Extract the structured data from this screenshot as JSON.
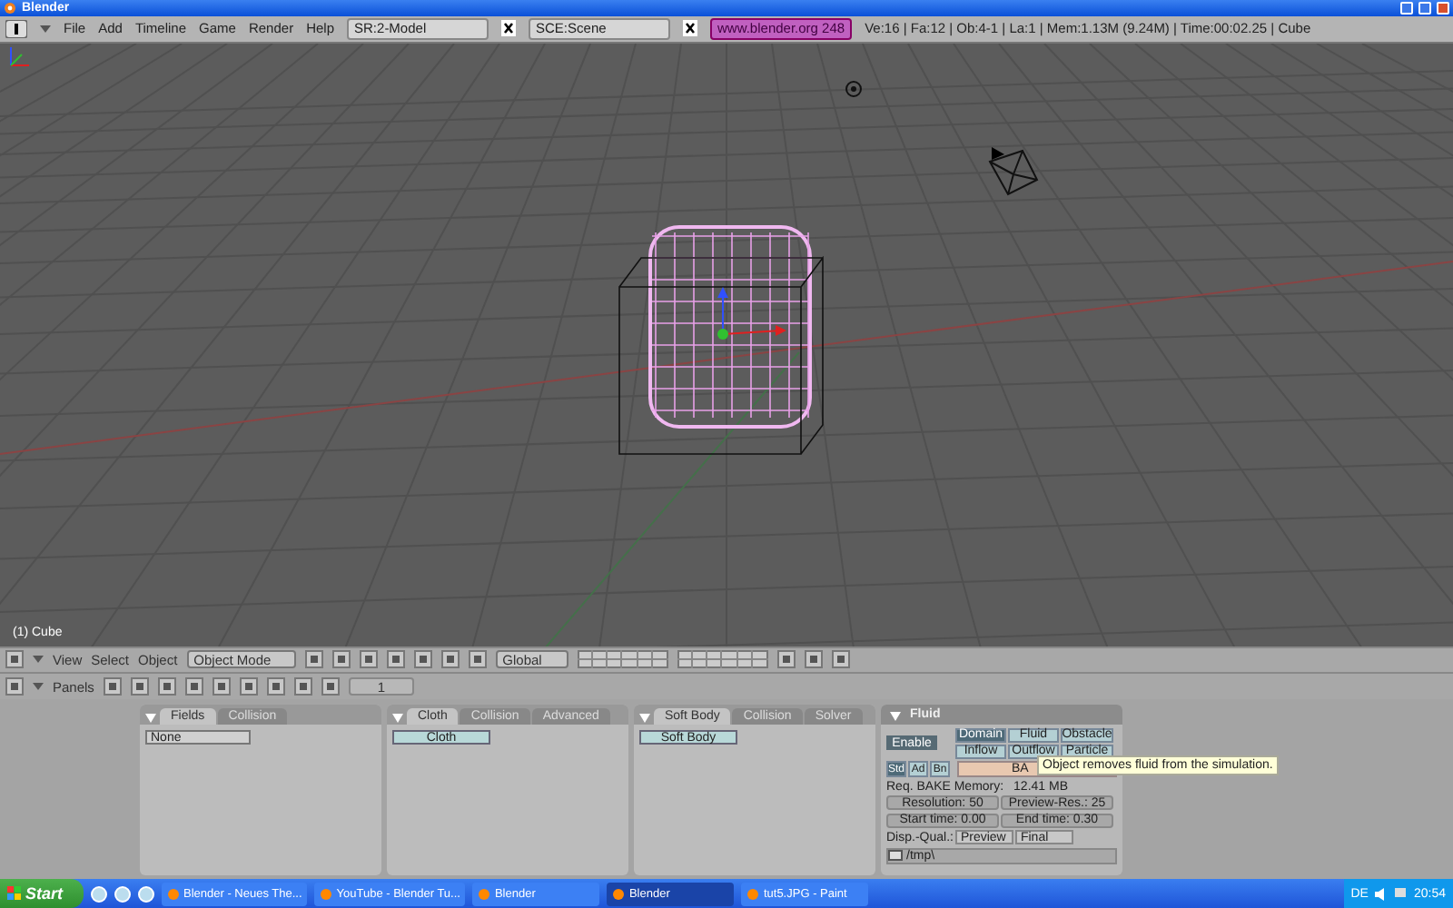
{
  "window": {
    "title": "Blender"
  },
  "info_header": {
    "menus": [
      "File",
      "Add",
      "Timeline",
      "Game",
      "Render",
      "Help"
    ],
    "screen": "SR:2-Model",
    "scene": "SCE:Scene",
    "link": "www.blender.org 248",
    "stats": "Ve:16 | Fa:12 | Ob:4-1 | La:1  | Mem:1.13M (9.24M)  | Time:00:02.25 | Cube"
  },
  "viewport": {
    "object_label": "(1) Cube"
  },
  "view3d_header": {
    "menus": [
      "View",
      "Select",
      "Object"
    ],
    "mode": "Object Mode",
    "orientation": "Global"
  },
  "buttons_header": {
    "label": "Panels",
    "frame": "1"
  },
  "panels": [
    {
      "tabs": [
        {
          "label": "Fields",
          "selected": true
        },
        {
          "label": "Collision",
          "selected": false
        }
      ],
      "control": {
        "kind": "dropdown",
        "label": "None"
      }
    },
    {
      "tabs": [
        {
          "label": "Cloth",
          "selected": true
        },
        {
          "label": "Collision",
          "selected": false
        },
        {
          "label": "Advanced",
          "selected": false
        }
      ],
      "control": {
        "kind": "button",
        "label": "Cloth"
      }
    },
    {
      "tabs": [
        {
          "label": "Soft Body",
          "selected": true
        },
        {
          "label": "Collision",
          "selected": false
        },
        {
          "label": "Solver",
          "selected": false
        }
      ],
      "control": {
        "kind": "button",
        "label": "Soft Body"
      }
    }
  ],
  "fluid_panel": {
    "title": "Fluid",
    "enable": "Enable",
    "types": [
      {
        "label": "Domain",
        "selected": true
      },
      {
        "label": "Fluid",
        "selected": false
      },
      {
        "label": "Obstacle",
        "selected": false
      },
      {
        "label": "Inflow",
        "selected": false
      },
      {
        "label": "Outflow",
        "selected": false
      },
      {
        "label": "Particle",
        "selected": false
      }
    ],
    "modes": [
      {
        "label": "Std",
        "selected": true
      },
      {
        "label": "Ad",
        "selected": false
      },
      {
        "label": "Bn",
        "selected": false
      }
    ],
    "bake": "BA",
    "memory_label": "Req. BAKE Memory:",
    "memory_value": "12.41 MB",
    "numbers": [
      "Resolution: 50",
      "Preview-Res.: 25",
      "Start time: 0.00",
      "End time: 0.30"
    ],
    "quality_label": "Disp.-Qual.:",
    "quality": [
      "Preview",
      "Final"
    ],
    "path": "/tmp\\"
  },
  "tooltip": "Object removes fluid from the simulation.",
  "taskbar": {
    "start": "Start",
    "tasks": [
      {
        "label": "Blender - Neues The...",
        "selected": false
      },
      {
        "label": "YouTube - Blender Tu...",
        "selected": false
      },
      {
        "label": "Blender",
        "selected": false
      },
      {
        "label": "Blender",
        "selected": true
      },
      {
        "label": "tut5.JPG - Paint",
        "selected": false
      }
    ],
    "language": "DE",
    "clock": "20:54"
  }
}
